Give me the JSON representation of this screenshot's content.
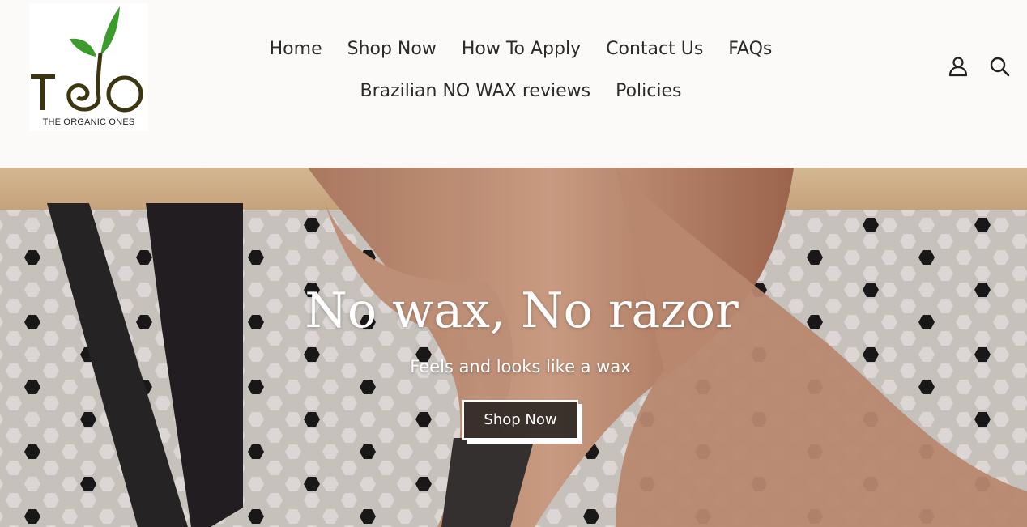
{
  "brand": {
    "logo_text": "THE ORGANIC ONES",
    "logo_monogram": "TOO",
    "logo_green": "#3d9a2c",
    "logo_brown": "#3b3512"
  },
  "nav": {
    "row1": [
      "Home",
      "Shop Now",
      "How To Apply",
      "Contact Us",
      "FAQs"
    ],
    "row2": [
      "Brazilian NO WAX reviews",
      "Policies"
    ]
  },
  "icons": {
    "account": "user-icon",
    "search": "search-icon"
  },
  "hero": {
    "title": "No wax, No razor",
    "subtitle": "Feels and looks like a wax",
    "button_label": "Shop Now"
  }
}
